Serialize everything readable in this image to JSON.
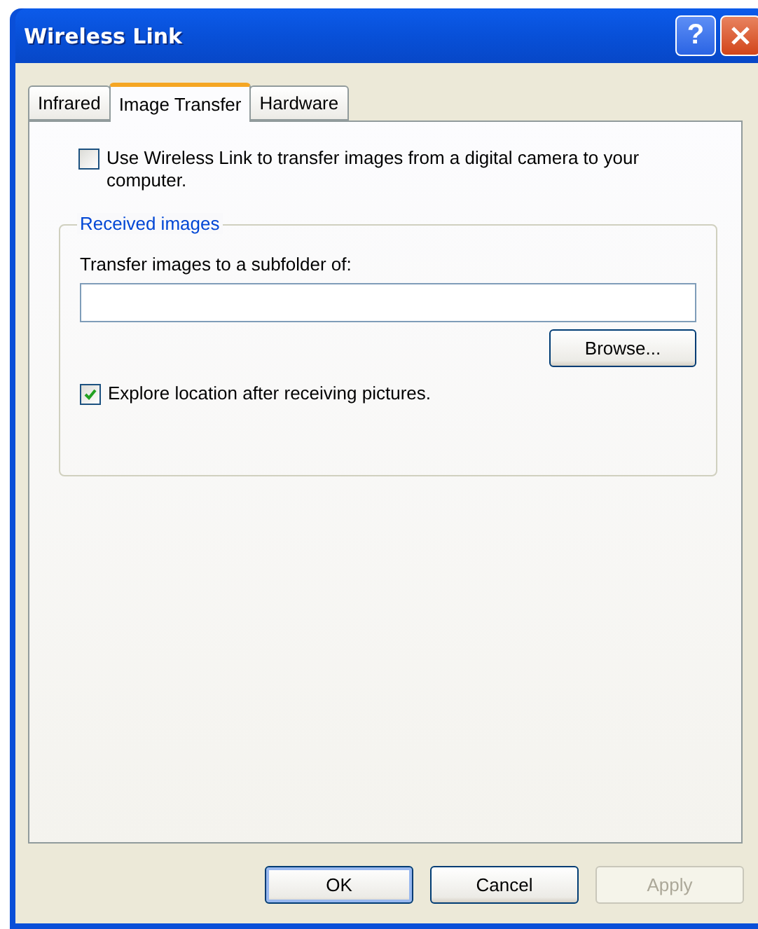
{
  "window": {
    "title": "Wireless Link",
    "controls": [
      {
        "kind": "help",
        "label": "?"
      },
      {
        "kind": "close"
      }
    ]
  },
  "tabs": [
    {
      "label": "Infrared",
      "selected": false
    },
    {
      "label": "Image Transfer",
      "selected": true
    },
    {
      "label": "Hardware",
      "selected": false
    }
  ],
  "use_checkbox": {
    "label": "Use Wireless Link to transfer images from a digital camera to your computer.",
    "checked": false
  },
  "group": {
    "title": "Received images",
    "field_label": "Transfer images to a subfolder of:",
    "browse": "Browse...",
    "explore": {
      "label": "Explore location after receiving pictures.",
      "checked": true
    }
  },
  "buttons": [
    {
      "label": "OK",
      "default": true,
      "disabled": false
    },
    {
      "label": "Cancel",
      "default": false,
      "disabled": false
    },
    {
      "label": "Apply",
      "default": false,
      "disabled": true
    }
  ]
}
